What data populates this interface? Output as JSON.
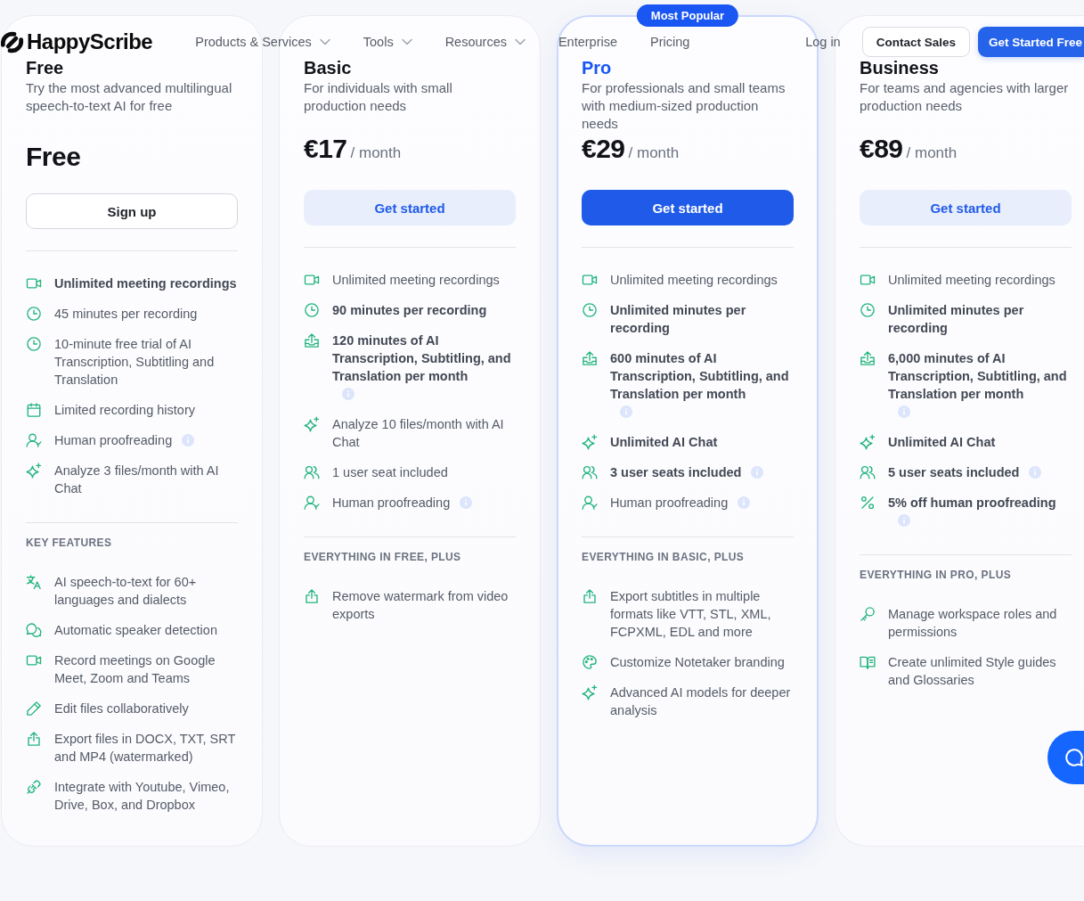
{
  "nav": {
    "logo": "HappyScribe",
    "links": [
      {
        "label": "Products & Services",
        "dropdown": true
      },
      {
        "label": "Tools",
        "dropdown": true
      },
      {
        "label": "Resources",
        "dropdown": true
      },
      {
        "label": "Enterprise",
        "dropdown": false
      },
      {
        "label": "Pricing",
        "dropdown": false
      }
    ],
    "login": "Log in",
    "contact": "Contact Sales",
    "cta": "Get Started Free"
  },
  "plans": [
    {
      "name": "Free",
      "featured": false,
      "description": "Try the most advanced multilingual speech-to-text AI for free",
      "price": {
        "amount": "Free"
      },
      "button": {
        "label": "Sign up",
        "kind": "outline"
      },
      "features": [
        {
          "kind": "video",
          "text": "Unlimited meeting recordings",
          "emphasis": true,
          "info": false
        },
        {
          "kind": "clock",
          "text": "45 minutes per recording",
          "emphasis": false,
          "info": false
        },
        {
          "kind": "clock",
          "text": "10-minute free trial of AI Transcription, Subtitling and Translation",
          "emphasis": false,
          "info": false
        },
        {
          "kind": "calendar",
          "text": "Limited recording history",
          "emphasis": false,
          "info": false
        },
        {
          "kind": "user-check",
          "text": "Human proofreading",
          "emphasis": false,
          "info": true
        },
        {
          "kind": "sparkles",
          "text": "Analyze 3 files/month with AI Chat",
          "emphasis": false,
          "info": false
        }
      ],
      "extras_heading": "KEY FEATURES",
      "extras": [
        {
          "kind": "translate",
          "text": "AI speech-to-text for 60+ languages and dialects"
        },
        {
          "kind": "chat",
          "text": "Automatic speaker detection"
        },
        {
          "kind": "video",
          "text": "Record meetings on Google Meet, Zoom and Teams"
        },
        {
          "kind": "pencil",
          "text": "Edit files collaboratively"
        },
        {
          "kind": "export",
          "text": "Export files in DOCX, TXT, SRT and MP4 (watermarked)"
        },
        {
          "kind": "plug",
          "text": "Integrate with Youtube, Vimeo, Drive, Box, and Dropbox"
        }
      ]
    },
    {
      "name": "Basic",
      "featured": false,
      "description": "For individuals with small production needs",
      "price": {
        "amount": "€17",
        "period": "/ month"
      },
      "button": {
        "label": "Get started",
        "kind": "soft"
      },
      "features": [
        {
          "kind": "video",
          "text": "Unlimited meeting recordings",
          "emphasis": false,
          "info": false
        },
        {
          "kind": "clock",
          "text": "90 minutes per recording",
          "emphasis": true,
          "info": false
        },
        {
          "kind": "upload",
          "text": "120 minutes of AI Transcription, Subtitling, and Translation per month",
          "emphasis": true,
          "info": true
        },
        {
          "kind": "sparkles",
          "text": "Analyze 10 files/month with AI Chat",
          "emphasis": false,
          "info": false
        },
        {
          "kind": "users",
          "text": "1 user seat included",
          "emphasis": false,
          "info": false
        },
        {
          "kind": "user-check",
          "text": "Human proofreading",
          "emphasis": false,
          "info": true
        }
      ],
      "extras_heading": "EVERYTHING IN FREE, PLUS",
      "extras": [
        {
          "kind": "export",
          "text": "Remove watermark from video exports"
        }
      ]
    },
    {
      "name": "Pro",
      "featured": true,
      "badge": "Most Popular",
      "description": "For professionals and small teams with medium-sized production needs",
      "price": {
        "amount": "€29",
        "period": "/ month"
      },
      "button": {
        "label": "Get started",
        "kind": "primary"
      },
      "features": [
        {
          "kind": "video",
          "text": "Unlimited meeting recordings",
          "emphasis": false,
          "info": false
        },
        {
          "kind": "clock",
          "text": "Unlimited minutes per recording",
          "emphasis": true,
          "info": false
        },
        {
          "kind": "upload",
          "text": "600 minutes of AI Transcription, Subtitling, and Translation per month",
          "emphasis": true,
          "info": true
        },
        {
          "kind": "sparkles",
          "text": "Unlimited AI Chat",
          "emphasis": true,
          "info": false
        },
        {
          "kind": "users",
          "text": "3 user seats included",
          "emphasis": true,
          "info": true
        },
        {
          "kind": "user-check",
          "text": "Human proofreading",
          "emphasis": false,
          "info": true
        }
      ],
      "extras_heading": "EVERYTHING IN BASIC, PLUS",
      "extras": [
        {
          "kind": "export",
          "text": "Export subtitles in multiple formats like VTT, STL, XML, FCPXML, EDL and more"
        },
        {
          "kind": "palette",
          "text": "Customize Notetaker branding"
        },
        {
          "kind": "sparkles",
          "text": "Advanced AI models for deeper analysis"
        }
      ]
    },
    {
      "name": "Business",
      "featured": false,
      "description": "For teams and agencies with larger production needs",
      "price": {
        "amount": "€89",
        "period": "/ month"
      },
      "button": {
        "label": "Get started",
        "kind": "soft"
      },
      "features": [
        {
          "kind": "video",
          "text": "Unlimited meeting recordings",
          "emphasis": false,
          "info": false
        },
        {
          "kind": "clock",
          "text": "Unlimited minutes per recording",
          "emphasis": true,
          "info": false
        },
        {
          "kind": "upload",
          "text": "6,000 minutes of AI Transcription, Subtitling, and Translation per month",
          "emphasis": true,
          "info": true
        },
        {
          "kind": "sparkles",
          "text": "Unlimited AI Chat",
          "emphasis": true,
          "info": false
        },
        {
          "kind": "users",
          "text": "5 user seats included",
          "emphasis": true,
          "info": true
        },
        {
          "kind": "percent",
          "text": "5% off human proofreading",
          "emphasis": true,
          "info": true
        }
      ],
      "extras_heading": "EVERYTHING IN PRO, PLUS",
      "extras": [
        {
          "kind": "key",
          "text": "Manage workspace roles and permissions"
        },
        {
          "kind": "book",
          "text": "Create unlimited Style guides and Glossaries"
        }
      ]
    }
  ]
}
